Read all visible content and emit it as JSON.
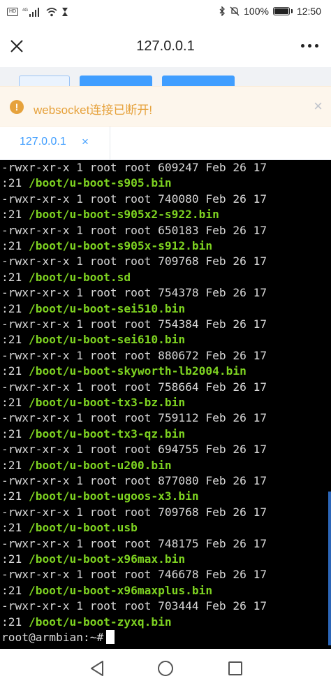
{
  "statusbar": {
    "left_icons": [
      "hd-icon",
      "4g-signal-icon",
      "signal-bars-icon",
      "wifi-icon",
      "hourglass-icon"
    ],
    "hd": "HD",
    "network": "4G",
    "battery_percent": "100%",
    "time": "12:50",
    "right_icons": [
      "bluetooth-icon",
      "mute-icon",
      "battery-icon"
    ]
  },
  "titlebar": {
    "title": "127.0.0.1"
  },
  "alert": {
    "icon": "!",
    "message": "websocket连接已断开!",
    "close": "×"
  },
  "tabs": [
    {
      "label": "127.0.0.1",
      "close": "×"
    }
  ],
  "terminal": {
    "lines": [
      {
        "text": "-rwxr-xr-x 1 root root 609247 Feb 26 17"
      },
      {
        "prefix": ":21 ",
        "path": "/boot/u-boot-s905.bin"
      },
      {
        "text": "-rwxr-xr-x 1 root root 740080 Feb 26 17"
      },
      {
        "prefix": ":21 ",
        "path": "/boot/u-boot-s905x2-s922.bin"
      },
      {
        "text": "-rwxr-xr-x 1 root root 650183 Feb 26 17"
      },
      {
        "prefix": ":21 ",
        "path": "/boot/u-boot-s905x-s912.bin"
      },
      {
        "text": "-rwxr-xr-x 1 root root 709768 Feb 26 17"
      },
      {
        "prefix": ":21 ",
        "path": "/boot/u-boot.sd"
      },
      {
        "text": "-rwxr-xr-x 1 root root 754378 Feb 26 17"
      },
      {
        "prefix": ":21 ",
        "path": "/boot/u-boot-sei510.bin"
      },
      {
        "text": "-rwxr-xr-x 1 root root 754384 Feb 26 17"
      },
      {
        "prefix": ":21 ",
        "path": "/boot/u-boot-sei610.bin"
      },
      {
        "text": "-rwxr-xr-x 1 root root 880672 Feb 26 17"
      },
      {
        "prefix": ":21 ",
        "path": "/boot/u-boot-skyworth-lb2004.bin"
      },
      {
        "text": "-rwxr-xr-x 1 root root 758664 Feb 26 17"
      },
      {
        "prefix": ":21 ",
        "path": "/boot/u-boot-tx3-bz.bin"
      },
      {
        "text": "-rwxr-xr-x 1 root root 759112 Feb 26 17"
      },
      {
        "prefix": ":21 ",
        "path": "/boot/u-boot-tx3-qz.bin"
      },
      {
        "text": "-rwxr-xr-x 1 root root 694755 Feb 26 17"
      },
      {
        "prefix": ":21 ",
        "path": "/boot/u-boot-u200.bin"
      },
      {
        "text": "-rwxr-xr-x 1 root root 877080 Feb 26 17"
      },
      {
        "prefix": ":21 ",
        "path": "/boot/u-boot-ugoos-x3.bin"
      },
      {
        "text": "-rwxr-xr-x 1 root root 709768 Feb 26 17"
      },
      {
        "prefix": ":21 ",
        "path": "/boot/u-boot.usb"
      },
      {
        "text": "-rwxr-xr-x 1 root root 748175 Feb 26 17"
      },
      {
        "prefix": ":21 ",
        "path": "/boot/u-boot-x96max.bin"
      },
      {
        "text": "-rwxr-xr-x 1 root root 746678 Feb 26 17"
      },
      {
        "prefix": ":21 ",
        "path": "/boot/u-boot-x96maxplus.bin"
      },
      {
        "text": "-rwxr-xr-x 1 root root 703444 Feb 26 17"
      },
      {
        "prefix": ":21 ",
        "path": "/boot/u-boot-zyxq.bin"
      }
    ],
    "prompt": "root@armbian:~#"
  },
  "colors": {
    "accent": "#409eff",
    "warning": "#e6a23c",
    "warning_bg": "#fdf6ec",
    "terminal_bg": "#000000",
    "terminal_text": "#d8d8d8",
    "terminal_path": "#7ed321"
  },
  "navbar": {
    "icons": [
      "back-triangle-icon",
      "home-circle-icon",
      "recent-square-icon"
    ]
  }
}
